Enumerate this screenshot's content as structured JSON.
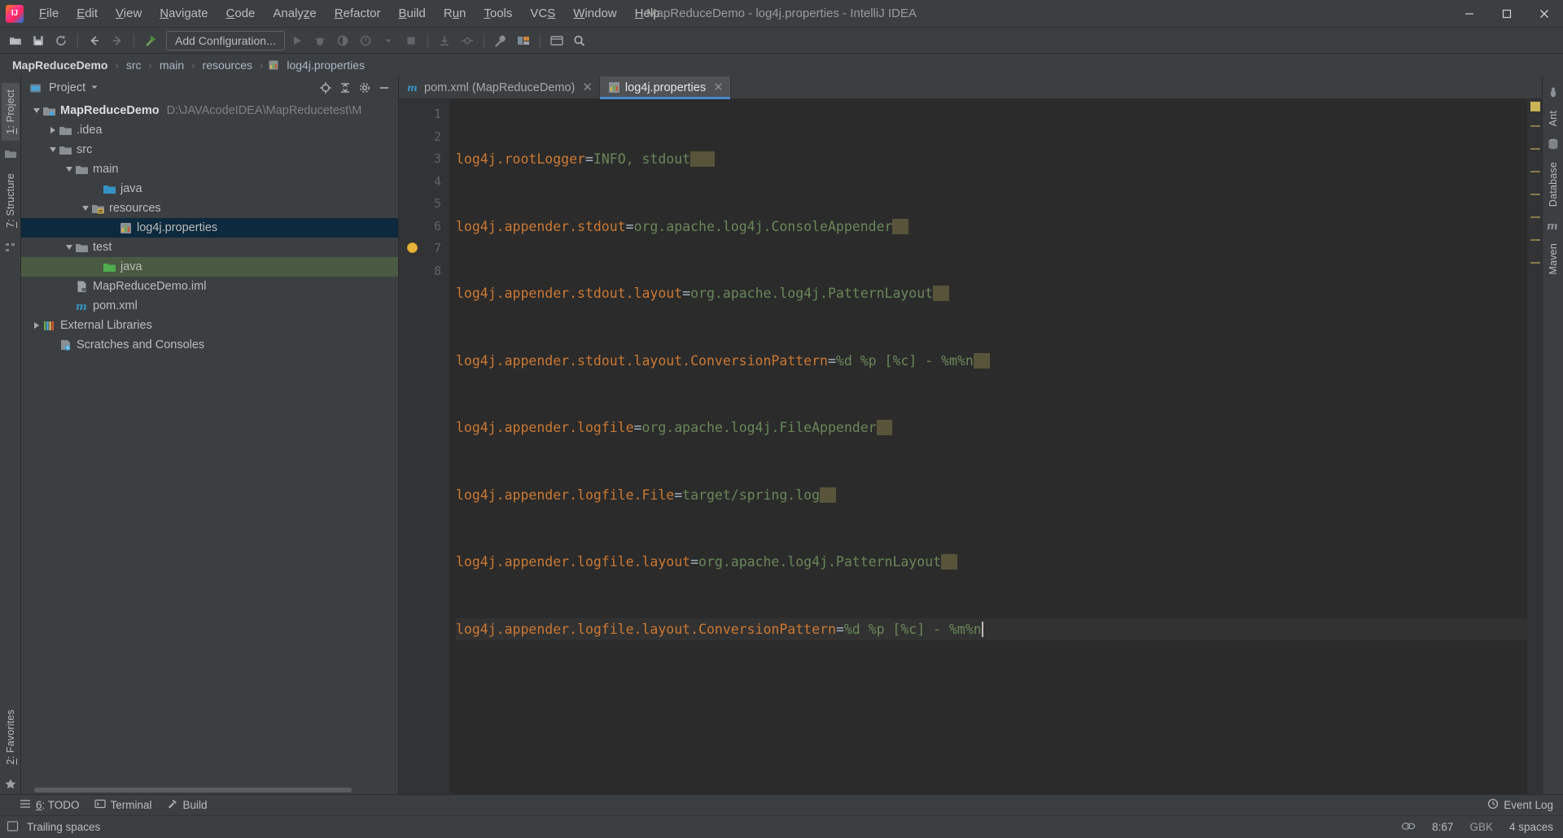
{
  "window": {
    "title": "MapReduceDemo - log4j.properties - IntelliJ IDEA",
    "minimize": "—",
    "maximize": "❐",
    "close": "✕"
  },
  "menu": [
    {
      "label": "File",
      "mnemonic": "F"
    },
    {
      "label": "Edit",
      "mnemonic": "E"
    },
    {
      "label": "View",
      "mnemonic": "V"
    },
    {
      "label": "Navigate",
      "mnemonic": "N"
    },
    {
      "label": "Code",
      "mnemonic": "C"
    },
    {
      "label": "Analyze",
      "mnemonic": "z"
    },
    {
      "label": "Refactor",
      "mnemonic": "R"
    },
    {
      "label": "Build",
      "mnemonic": "B"
    },
    {
      "label": "Run",
      "mnemonic": "u"
    },
    {
      "label": "Tools",
      "mnemonic": "T"
    },
    {
      "label": "VCS",
      "mnemonic": "S"
    },
    {
      "label": "Window",
      "mnemonic": "W"
    },
    {
      "label": "Help",
      "mnemonic": "H"
    }
  ],
  "toolbar": {
    "add_configuration": "Add Configuration...",
    "icons": [
      "open-folder-icon",
      "save-all-icon",
      "sync-refresh-icon",
      "back-arrow-icon",
      "forward-arrow-icon",
      "build-hammer-icon"
    ],
    "run_icons": [
      "run-icon",
      "debug-icon",
      "run-coverage-icon",
      "profile-icon",
      "dropdown-arrow-icon",
      "stop-icon"
    ],
    "right_icons": [
      "update-project-icon",
      "commit-icon",
      "settings-wrench-icon",
      "project-structure-icon",
      "terminal-window-icon",
      "search-everywhere-icon"
    ]
  },
  "breadcrumb": {
    "separator": "›",
    "items": [
      {
        "label": "MapReduceDemo",
        "icon": "project-icon",
        "root": true
      },
      {
        "label": "src",
        "icon": "folder-icon",
        "root": false
      },
      {
        "label": "main",
        "icon": "folder-icon",
        "root": false
      },
      {
        "label": "resources",
        "icon": "folder-icon",
        "root": false
      },
      {
        "label": "log4j.properties",
        "icon": "properties-file-icon",
        "root": false
      }
    ]
  },
  "left_rail": {
    "tabs": [
      {
        "label": "1: Project",
        "mnemonic": "1",
        "active": true
      },
      {
        "label": "7: Structure",
        "mnemonic": "7",
        "active": false
      },
      {
        "label": "2: Favorites",
        "mnemonic": "2",
        "active": false
      }
    ]
  },
  "right_rail": {
    "tabs": [
      "Ant",
      "Database",
      "Maven"
    ]
  },
  "project_panel": {
    "title": "Project",
    "dropdown_icon": "chevron-down-icon",
    "actions": [
      "locate-target-icon",
      "collapse-all-icon",
      "settings-gear-icon",
      "hide-panel-icon"
    ],
    "tree": [
      {
        "label": "MapReduceDemo",
        "path": "D:\\JAVAcodeIDEA\\MapReducetest\\M",
        "depth": 0,
        "state": "expanded",
        "icon": "project-module-icon",
        "bold": true,
        "selected": false,
        "highlight": "none"
      },
      {
        "label": ".idea",
        "path": "",
        "depth": 1,
        "state": "collapsed",
        "icon": "folder-icon",
        "bold": false,
        "selected": false,
        "highlight": "none"
      },
      {
        "label": "src",
        "path": "",
        "depth": 1,
        "state": "expanded",
        "icon": "folder-icon",
        "bold": false,
        "selected": false,
        "highlight": "none"
      },
      {
        "label": "main",
        "path": "",
        "depth": 2,
        "state": "expanded",
        "icon": "folder-icon",
        "bold": false,
        "selected": false,
        "highlight": "none"
      },
      {
        "label": "java",
        "path": "",
        "depth": 3,
        "state": "leaf",
        "icon": "source-root-icon",
        "bold": false,
        "selected": false,
        "highlight": "none"
      },
      {
        "label": "resources",
        "path": "",
        "depth": 3,
        "state": "expanded",
        "icon": "resources-root-icon",
        "bold": false,
        "selected": false,
        "highlight": "none"
      },
      {
        "label": "log4j.properties",
        "path": "",
        "depth": 4,
        "state": "leaf",
        "icon": "properties-file-icon",
        "bold": false,
        "selected": true,
        "highlight": "blue"
      },
      {
        "label": "test",
        "path": "",
        "depth": 2,
        "state": "expanded",
        "icon": "folder-icon",
        "bold": false,
        "selected": false,
        "highlight": "none"
      },
      {
        "label": "java",
        "path": "",
        "depth": 3,
        "state": "leaf",
        "icon": "test-source-root-icon",
        "bold": false,
        "selected": false,
        "highlight": "green"
      },
      {
        "label": "MapReduceDemo.iml",
        "path": "",
        "depth": 1,
        "state": "leaf",
        "icon": "iml-file-icon",
        "bold": false,
        "selected": false,
        "highlight": "none"
      },
      {
        "label": "pom.xml",
        "path": "",
        "depth": 1,
        "state": "leaf",
        "icon": "maven-file-icon",
        "bold": false,
        "selected": false,
        "highlight": "none"
      },
      {
        "label": "External Libraries",
        "path": "",
        "depth": 0,
        "state": "collapsed",
        "icon": "libraries-icon",
        "bold": false,
        "selected": false,
        "highlight": "none"
      },
      {
        "label": "Scratches and Consoles",
        "path": "",
        "depth": 0,
        "state": "leaf",
        "icon": "scratches-icon",
        "bold": false,
        "selected": false,
        "highlight": "none"
      }
    ]
  },
  "editor": {
    "tabs": [
      {
        "label": "pom.xml (MapReduceDemo)",
        "icon": "maven-file-icon",
        "active": false,
        "close": "✕"
      },
      {
        "label": "log4j.properties",
        "icon": "properties-file-icon",
        "active": true,
        "close": "✕"
      }
    ],
    "line_numbers": [
      "1",
      "2",
      "3",
      "4",
      "5",
      "6",
      "7",
      "8"
    ],
    "lines": [
      {
        "key": "log4j.rootLogger",
        "eq": "=",
        "value": "INFO, stdout",
        "trailing": "   ",
        "current": false
      },
      {
        "key": "log4j.appender.stdout",
        "eq": "=",
        "value": "org.apache.log4j.ConsoleAppender",
        "trailing": "  ",
        "current": false
      },
      {
        "key": "log4j.appender.stdout.layout",
        "eq": "=",
        "value": "org.apache.log4j.PatternLayout",
        "trailing": "  ",
        "current": false
      },
      {
        "key": "log4j.appender.stdout.layout.ConversionPattern",
        "eq": "=",
        "value": "%d %p [%c] - %m%n",
        "trailing": "  ",
        "current": false
      },
      {
        "key": "log4j.appender.logfile",
        "eq": "=",
        "value": "org.apache.log4j.FileAppender",
        "trailing": "  ",
        "current": false
      },
      {
        "key": "log4j.appender.logfile.File",
        "eq": "=",
        "value": "target/spring.log",
        "trailing": "  ",
        "current": false
      },
      {
        "key": "log4j.appender.logfile.layout",
        "eq": "=",
        "value": "org.apache.log4j.PatternLayout",
        "trailing": "  ",
        "current": false
      },
      {
        "key": "log4j.appender.logfile.layout.ConversionPattern",
        "eq": "=",
        "value": "%d %p [%c] - %m%n",
        "trailing": "",
        "current": true
      }
    ],
    "intention_bulb": "intention-bulb-icon"
  },
  "status": {
    "tool_buttons": [
      {
        "label": "6: TODO",
        "mnemonic": "6",
        "icon": "todo-icon"
      },
      {
        "label": "Terminal",
        "mnemonic": "",
        "icon": "terminal-icon"
      },
      {
        "label": "Build",
        "mnemonic": "",
        "icon": "build-hammer-icon"
      }
    ],
    "event_log": "Event Log",
    "event_log_icon": "event-log-icon",
    "message": "Trailing spaces",
    "message_icon": "status-info-icon",
    "caret_position": "8:67",
    "encoding": "GBK",
    "indent": "4 spaces",
    "notification_icon": "notifications-icon"
  },
  "colors": {
    "accent": "#4a88c7",
    "selection": "#0d293e",
    "test_source": "#4a5a42",
    "key": "#cc7832",
    "value": "#6a8759",
    "whitespace_marker": "#58543a",
    "editor_bg": "#2b2b2b",
    "panel_bg": "#3c3f41"
  }
}
